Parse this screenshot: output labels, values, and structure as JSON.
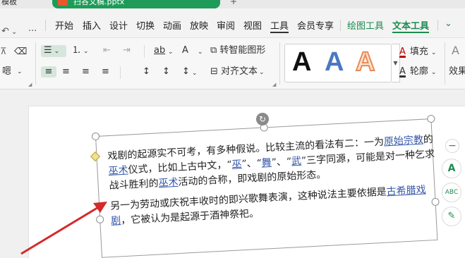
{
  "tabs": {
    "previous": "模板",
    "active": "扫谷文稿.pptx",
    "new_tab": "+"
  },
  "quick_access": {
    "undo": "↶",
    "dropdown": "⌄",
    "more": "···"
  },
  "menu": {
    "items": [
      "开始",
      "插入",
      "设计",
      "切换",
      "动画",
      "放映",
      "审阅",
      "视图",
      "工具",
      "会员专享"
    ],
    "context": [
      "绘图工具",
      "文本工具"
    ],
    "active_context": "文本工具"
  },
  "ribbon": {
    "row1": {
      "clear_format": "⌫",
      "bullets": "☰",
      "numbering": "⒈",
      "indent_less": "⇤",
      "indent_more": "⇥",
      "char_spacing": "ab",
      "text_direction": "A",
      "convert_smartart": "转智能图形",
      "fill": "填充",
      "fill_color": "#c00000"
    },
    "row2": {
      "char_label": "嗯",
      "align_left": "≡",
      "align_center": "≡",
      "align_right": "≡",
      "justify": "≡",
      "line_spacing": "↕",
      "para_spacing": "↕",
      "text_align": "对齐文本",
      "outline": "轮廓",
      "effect": "效果"
    },
    "wordart": [
      "A",
      "A",
      "A"
    ]
  },
  "slide": {
    "rotate_icon": "↻",
    "paragraph1": [
      {
        "t": "戏剧的起源实不可考，有多种假说。比较主流的看法有二：一为"
      },
      {
        "t": "原始宗教",
        "link": true
      },
      {
        "t": "的"
      },
      {
        "t": "巫术",
        "link": true
      },
      {
        "t": "仪式，比如上古中文，“"
      },
      {
        "t": "巫",
        "link": true
      },
      {
        "t": "”、“"
      },
      {
        "t": "舞",
        "link": true
      },
      {
        "t": "”、“"
      },
      {
        "t": "武",
        "link": true
      },
      {
        "t": "”三字同源，可能是对一种乞求战斗胜利的"
      },
      {
        "t": "巫术",
        "link": true
      },
      {
        "t": "活动的合称，即戏剧的原始形态。"
      }
    ],
    "paragraph2": [
      {
        "t": "另一为劳动或庆祝丰收时的即兴歌舞表演，这种说法主要依据是"
      },
      {
        "t": "古希腊戏剧",
        "link": true
      },
      {
        "t": "，它被认为是起源于酒神祭祀。"
      }
    ]
  },
  "side_tools": [
    "−",
    "A",
    "ABC",
    "✎"
  ]
}
